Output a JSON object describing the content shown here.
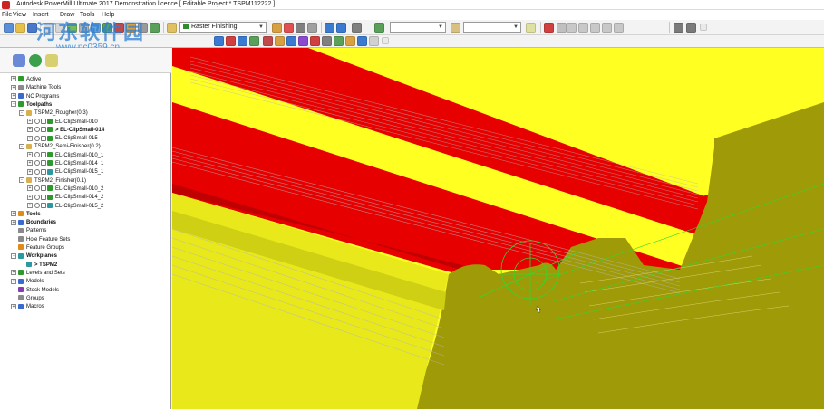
{
  "window": {
    "title": "Autodesk PowerMill Ultimate 2017 Demonstration licence   [ Editable Project * TSPM112222 ]"
  },
  "menu": [
    "File",
    "View",
    "Insert",
    "Draw",
    "Tools",
    "Help"
  ],
  "watermark": {
    "text": "河东软件园",
    "url": "www.pc0359.cn"
  },
  "toolbar": {
    "strategy_value": "Raster Finishing",
    "blank_combo_value": "",
    "colors": {
      "green": "#2e8b2e",
      "blue": "#1b63c6",
      "red": "#d62020",
      "orange": "#e88a1a"
    }
  },
  "explorer": {
    "tree": [
      {
        "label": "Active",
        "level": 0,
        "expander": "+",
        "icon": "green"
      },
      {
        "label": "Machine Tools",
        "level": 0,
        "expander": "+",
        "icon": "gray"
      },
      {
        "label": "NC Programs",
        "level": 0,
        "expander": "+",
        "icon": "blue"
      },
      {
        "label": "Toolpaths",
        "level": 0,
        "expander": "-",
        "icon": "green",
        "bold": true
      },
      {
        "label": "TSPM2_Rougher(0.3)",
        "level": 1,
        "expander": "-",
        "icon": "folder"
      },
      {
        "label": "EL-ClipSmall-010",
        "level": 2,
        "expander": "+",
        "icon": "green",
        "check": true
      },
      {
        "label": "> EL-ClipSmall-014",
        "level": 2,
        "expander": "+",
        "icon": "green",
        "check": true,
        "bold": true
      },
      {
        "label": "EL-ClipSmall-015",
        "level": 2,
        "expander": "+",
        "icon": "green",
        "check": true
      },
      {
        "label": "TSPM2_Semi-Finisher(0.2)",
        "level": 1,
        "expander": "-",
        "icon": "folder"
      },
      {
        "label": "EL-ClipSmall-010_1",
        "level": 2,
        "expander": "+",
        "icon": "green",
        "check": true
      },
      {
        "label": "EL-ClipSmall-014_1",
        "level": 2,
        "expander": "+",
        "icon": "green",
        "check": true
      },
      {
        "label": "EL-ClipSmall-015_1",
        "level": 2,
        "expander": "+",
        "icon": "teal",
        "check": true
      },
      {
        "label": "TSPM2_Finisher(0.1)",
        "level": 1,
        "expander": "-",
        "icon": "folder"
      },
      {
        "label": "EL-ClipSmall-010_2",
        "level": 2,
        "expander": "+",
        "icon": "green",
        "check": true
      },
      {
        "label": "EL-ClipSmall-014_2",
        "level": 2,
        "expander": "+",
        "icon": "green",
        "check": true
      },
      {
        "label": "EL-ClipSmall-015_2",
        "level": 2,
        "expander": "+",
        "icon": "teal",
        "check": true
      },
      {
        "label": "Tools",
        "level": 0,
        "expander": "+",
        "icon": "orange",
        "bold": true
      },
      {
        "label": "Boundaries",
        "level": 0,
        "expander": "+",
        "icon": "blue",
        "bold": true
      },
      {
        "label": "Patterns",
        "level": 0,
        "expander": "",
        "icon": "gray"
      },
      {
        "label": "Hole Feature Sets",
        "level": 0,
        "expander": "",
        "icon": "gray"
      },
      {
        "label": "Feature Groups",
        "level": 0,
        "expander": "",
        "icon": "orange"
      },
      {
        "label": "Workplanes",
        "level": 0,
        "expander": "-",
        "icon": "teal",
        "bold": true
      },
      {
        "label": "> TSPM2",
        "level": 1,
        "expander": "",
        "icon": "teal",
        "bold": true
      },
      {
        "label": "Levels and Sets",
        "level": 0,
        "expander": "+",
        "icon": "green"
      },
      {
        "label": "Models",
        "level": 0,
        "expander": "+",
        "icon": "blue"
      },
      {
        "label": "Stock Models",
        "level": 0,
        "expander": "",
        "icon": "purple"
      },
      {
        "label": "Groups",
        "level": 0,
        "expander": "",
        "icon": "gray"
      },
      {
        "label": "Macros",
        "level": 0,
        "expander": "+",
        "icon": "blue"
      }
    ]
  },
  "viewport": {
    "colors": {
      "yellow": "#ffff22",
      "red": "#e60000",
      "olive": "#9e9a08",
      "toolpath": "#30d830"
    }
  }
}
